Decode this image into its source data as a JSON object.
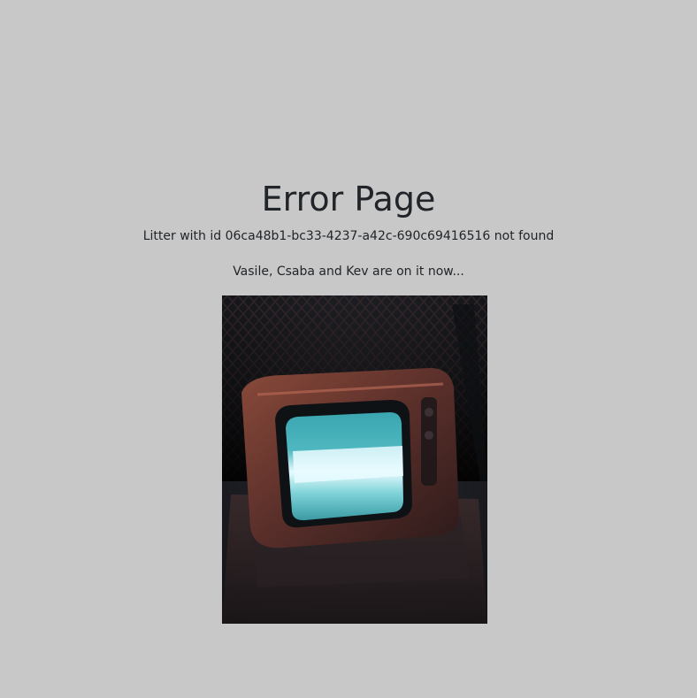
{
  "page": {
    "title": "Error Page",
    "message": "Litter with id 06ca48b1-bc33-4237-a42c-690c69416516 not found",
    "subtext": "Vasile, Csaba and Kev are on it now..."
  },
  "image": {
    "subject": "retro-television-icon"
  },
  "colors": {
    "background": "#c8c8c8",
    "text": "#212529"
  }
}
